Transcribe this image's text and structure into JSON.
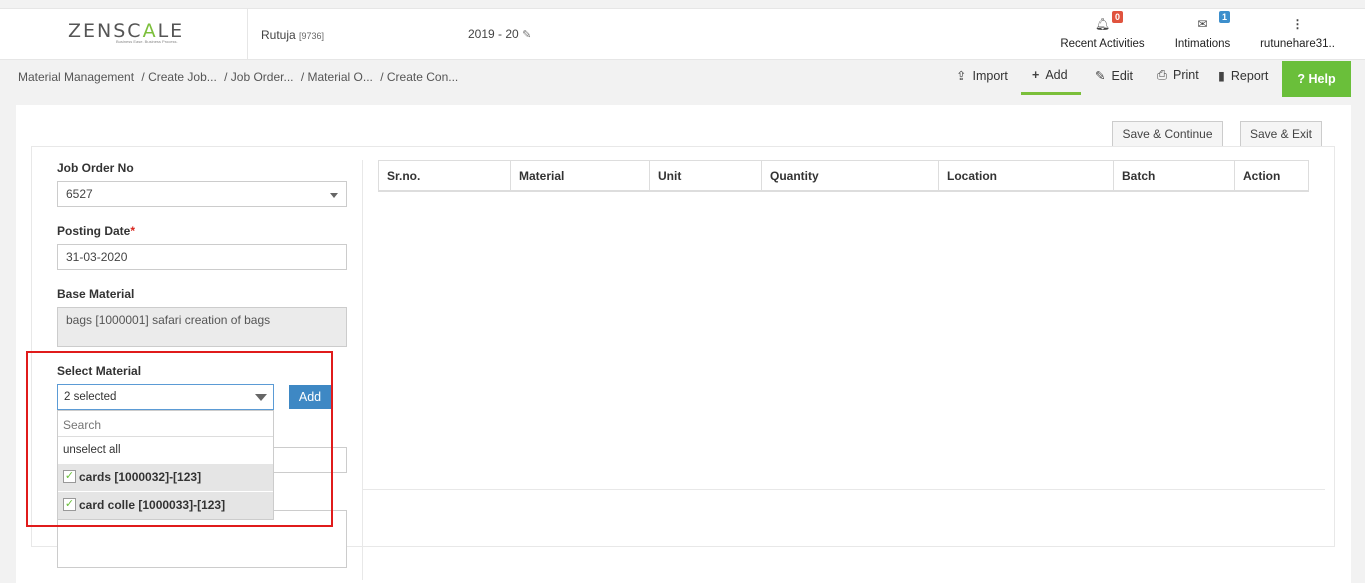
{
  "header": {
    "logo_prefix": "ZENSC",
    "logo_accent": "A",
    "logo_suffix": "LE",
    "logo_tagline": "Business Ease. Business Process.",
    "user_name": "Rutuja",
    "user_id": "[9736]",
    "fiscal_year": "2019 - 20",
    "recent_activities": {
      "label": "Recent Activities",
      "count": "0"
    },
    "intimations": {
      "label": "Intimations",
      "count": "1"
    },
    "user_menu": {
      "label": "rutunehare31.."
    }
  },
  "breadcrumb": [
    "Material Management",
    "/ Create Job...",
    "/ Job Order...",
    "/ Material O...",
    "/ Create Con..."
  ],
  "toolbar": {
    "import": "Import",
    "add": "Add",
    "edit": "Edit",
    "print": "Print",
    "report": "Report",
    "help": "Help"
  },
  "actions": {
    "save_continue": "Save & Continue",
    "save_exit": "Save & Exit"
  },
  "form": {
    "job_order_label": "Job Order No",
    "job_order_value": "6527",
    "posting_date_label": "Posting Date",
    "posting_date_required": "*",
    "posting_date_value": "31-03-2020",
    "base_material_label": "Base Material",
    "base_material_value": "bags [1000001] safari creation of bags",
    "select_material_label": "Select Material",
    "select_material_value": "2 selected",
    "add_button": "Add",
    "dropdown": {
      "search_placeholder": "Search",
      "unselect_all": "unselect all",
      "options": [
        {
          "label": "cards [1000032]-[123]",
          "checked": true
        },
        {
          "label": "card colle [1000033]-[123]",
          "checked": true
        }
      ]
    }
  },
  "table": {
    "columns": [
      "Sr.no.",
      "Material",
      "Unit",
      "Quantity",
      "Location",
      "Batch",
      "Action"
    ]
  },
  "colors": {
    "accent_green": "#6abf3a",
    "primary_blue": "#3e88c4",
    "highlight_red": "#e01b1b"
  }
}
